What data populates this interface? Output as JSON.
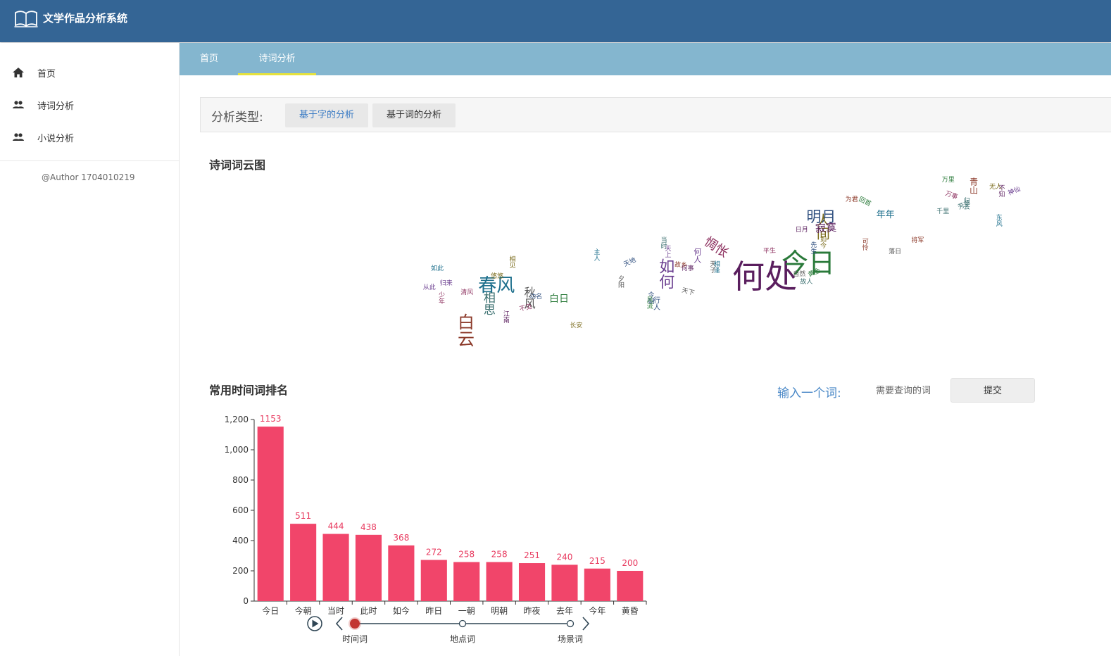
{
  "app": {
    "title": "文学作品分析系统"
  },
  "sidebar": {
    "items": [
      {
        "label": "首页",
        "icon": "home-icon"
      },
      {
        "label": "诗词分析",
        "icon": "users-icon"
      },
      {
        "label": "小说分析",
        "icon": "users-icon"
      }
    ],
    "author": "@Author 1704010219"
  },
  "tabs": [
    {
      "label": "首页",
      "active": false
    },
    {
      "label": "诗词分析",
      "active": true
    }
  ],
  "filter": {
    "label": "分析类型:",
    "options": [
      {
        "label": "基于字的分析",
        "active": true
      },
      {
        "label": "基于词的分析",
        "active": false
      }
    ]
  },
  "wordcloud": {
    "title": "诗词词云图",
    "words": [
      "何处",
      "今日",
      "春风",
      "白云",
      "如何",
      "明月",
      "人间",
      "惆怅",
      "相思",
      "秋风",
      "寂寞",
      "白日",
      "年年",
      "青山",
      "何人",
      "行人",
      "悠悠",
      "少年",
      "故人",
      "天子",
      "何事",
      "回首",
      "东风",
      "可怜",
      "从此",
      "今朝",
      "长安",
      "平生",
      "千里",
      "落日",
      "江南",
      "黄金",
      "如此",
      "将军",
      "归来",
      "天地",
      "相见",
      "清风",
      "当时",
      "天下",
      "日月",
      "万里",
      "主人",
      "故乡",
      "天上",
      "先生",
      "如今",
      "万事",
      "归去",
      "自然",
      "不知",
      "风流",
      "相逢",
      "为君",
      "神仙",
      "功名",
      "无人",
      "不见",
      "芳草",
      "夕阳"
    ]
  },
  "query": {
    "label": "输入一个词:",
    "placeholder": "需要查询的词",
    "submit": "提交"
  },
  "chart_data": {
    "type": "bar",
    "title": "常用时间词排名",
    "categories": [
      "今日",
      "今朝",
      "当时",
      "此时",
      "如今",
      "昨日",
      "一朝",
      "明朝",
      "昨夜",
      "去年",
      "今年",
      "黄昏"
    ],
    "values": [
      1153,
      511,
      444,
      438,
      368,
      272,
      258,
      258,
      251,
      240,
      215,
      200
    ],
    "ylim": [
      0,
      1200
    ],
    "yticks": [
      "0",
      "200",
      "400",
      "600",
      "800",
      "1,000",
      "1,200"
    ],
    "bar_color": "#f1456a",
    "label_color": "#e83a5f",
    "grid": false,
    "timeline": {
      "points": [
        "时间词",
        "地点词",
        "场景词"
      ],
      "active_index": 0
    }
  },
  "colors": {
    "header": "#346595",
    "tabbar": "#84b6cf",
    "tab_indicator": "#e6e23c",
    "accent": "#4a88c7"
  }
}
